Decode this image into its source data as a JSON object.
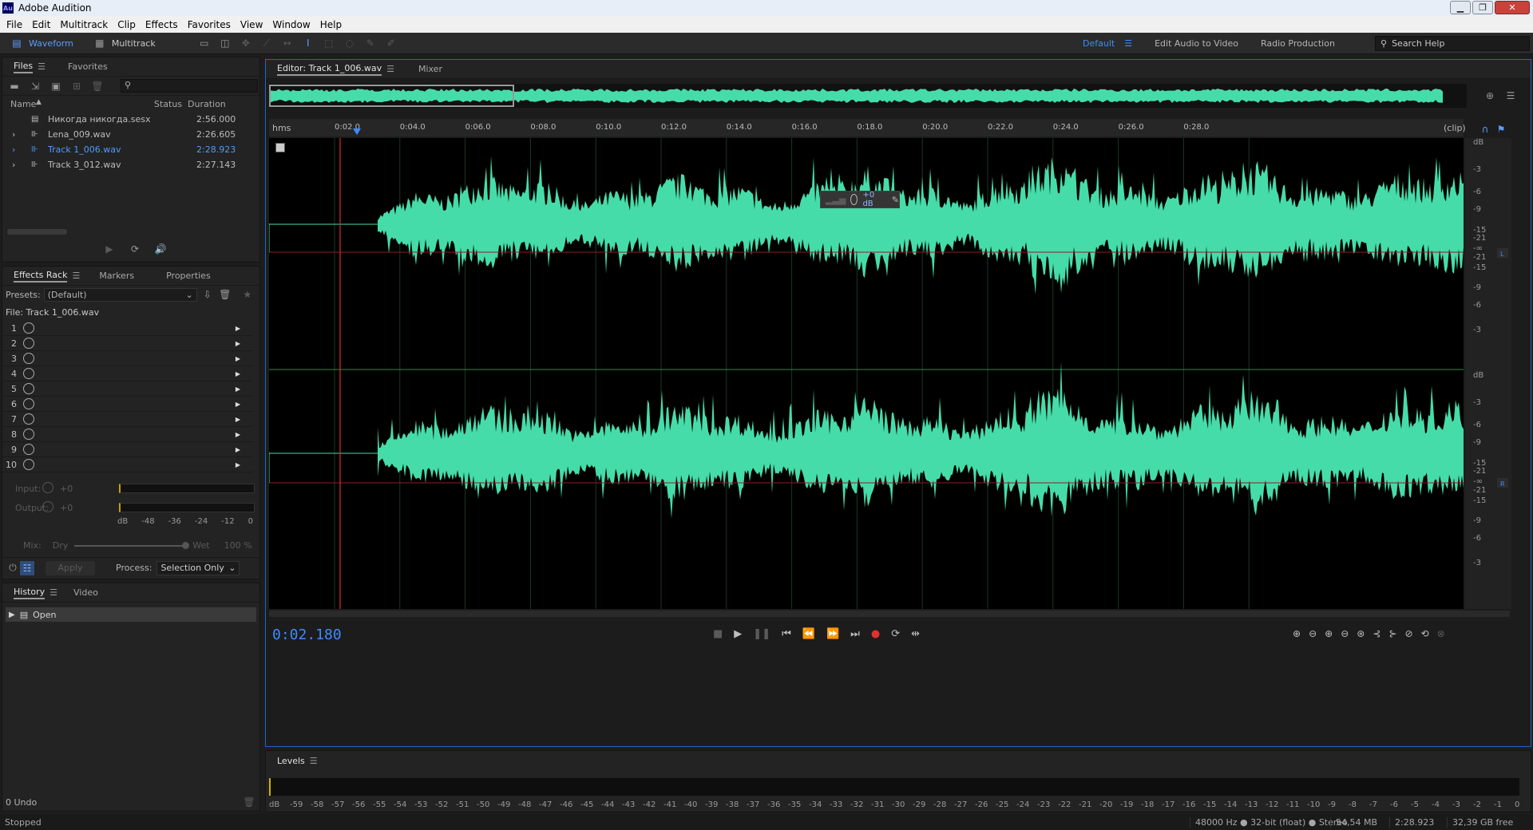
{
  "app": {
    "title": "Adobe Audition",
    "logo": "Au"
  },
  "menu": [
    "File",
    "Edit",
    "Multitrack",
    "Clip",
    "Effects",
    "Favorites",
    "View",
    "Window",
    "Help"
  ],
  "toolbar": {
    "waveform": "Waveform",
    "multitrack": "Multitrack"
  },
  "workspaces": {
    "current": "Default",
    "items": [
      "Edit Audio to Video",
      "Radio Production"
    ],
    "more": "»"
  },
  "search": {
    "placeholder": "Search Help"
  },
  "files": {
    "tab_files": "Files",
    "tab_favorites": "Favorites",
    "col_name": "Name",
    "col_status": "Status",
    "col_duration": "Duration",
    "rows": [
      {
        "name": "Никогда никогда.sesx",
        "duration": "2:56.000",
        "icon": "session-icon",
        "selected": false
      },
      {
        "name": "Lena_009.wav",
        "duration": "2:26.605",
        "icon": "waveform-file-icon",
        "selected": false
      },
      {
        "name": "Track 1_006.wav",
        "duration": "2:28.923",
        "icon": "waveform-file-icon",
        "selected": true
      },
      {
        "name": "Track 3_012.wav",
        "duration": "2:27.143",
        "icon": "waveform-file-icon",
        "selected": false
      }
    ]
  },
  "effects": {
    "tab_rack": "Effects Rack",
    "tab_markers": "Markers",
    "tab_properties": "Properties",
    "presets_label": "Presets:",
    "preset_value": "(Default)",
    "file_label": "File: Track 1_006.wav",
    "slots": [
      "1",
      "2",
      "3",
      "4",
      "5",
      "6",
      "7",
      "8",
      "9",
      "10"
    ],
    "input_label": "Input:",
    "output_label": "Output:",
    "input_val": "+0",
    "output_val": "+0",
    "meter_ticks": [
      "dB",
      "-48",
      "-36",
      "-24",
      "-12",
      "0"
    ],
    "mix_label": "Mix:",
    "dry": "Dry",
    "wet": "Wet",
    "wet_pct": "100 %",
    "apply": "Apply",
    "process_label": "Process:",
    "process_value": "Selection Only"
  },
  "history": {
    "tab_history": "History",
    "tab_video": "Video",
    "items": [
      "Open"
    ],
    "undo": "0 Undo"
  },
  "editor": {
    "tab": "Editor: Track 1_006.wav",
    "mixer": "Mixer",
    "ruler_unit": "hms",
    "ruler_clip": "(clip)",
    "ticks": [
      "0:02.0",
      "0:04.0",
      "0:06.0",
      "0:08.0",
      "0:10.0",
      "0:12.0",
      "0:14.0",
      "0:16.0",
      "0:18.0",
      "0:20.0",
      "0:22.0",
      "0:24.0",
      "0:26.0",
      "0:28.0"
    ],
    "hud_gain": "+0 dB",
    "db_unit": "dB",
    "db_ticks": [
      "-3",
      "-6",
      "-9",
      "-15",
      "-21",
      "-∞",
      "-21",
      "-15",
      "-9",
      "-6",
      "-3"
    ],
    "channel_left": "L",
    "channel_right": "R",
    "time": "0:02.180"
  },
  "levels": {
    "title": "Levels",
    "scale": [
      "dB",
      "-59",
      "-58",
      "-57",
      "-56",
      "-55",
      "-54",
      "-53",
      "-52",
      "-51",
      "-50",
      "-49",
      "-48",
      "-47",
      "-46",
      "-45",
      "-44",
      "-43",
      "-42",
      "-41",
      "-40",
      "-39",
      "-38",
      "-37",
      "-36",
      "-35",
      "-34",
      "-33",
      "-32",
      "-31",
      "-30",
      "-29",
      "-28",
      "-27",
      "-26",
      "-25",
      "-24",
      "-23",
      "-22",
      "-21",
      "-20",
      "-19",
      "-18",
      "-17",
      "-16",
      "-15",
      "-14",
      "-13",
      "-12",
      "-11",
      "-10",
      "-9",
      "-8",
      "-7",
      "-6",
      "-5",
      "-4",
      "-3",
      "-2",
      "-1",
      "0"
    ]
  },
  "status": {
    "state": "Stopped",
    "format": "48000 Hz ● 32-bit (float) ● Stereo",
    "size": "54,54 MB",
    "duration": "2:28.923",
    "free": "32,39 GB free"
  },
  "colors": {
    "accent": "#3d8bff",
    "waveform": "#46dcaa",
    "playhead": "#e02a2a",
    "selection_border": "#1f66c6"
  }
}
